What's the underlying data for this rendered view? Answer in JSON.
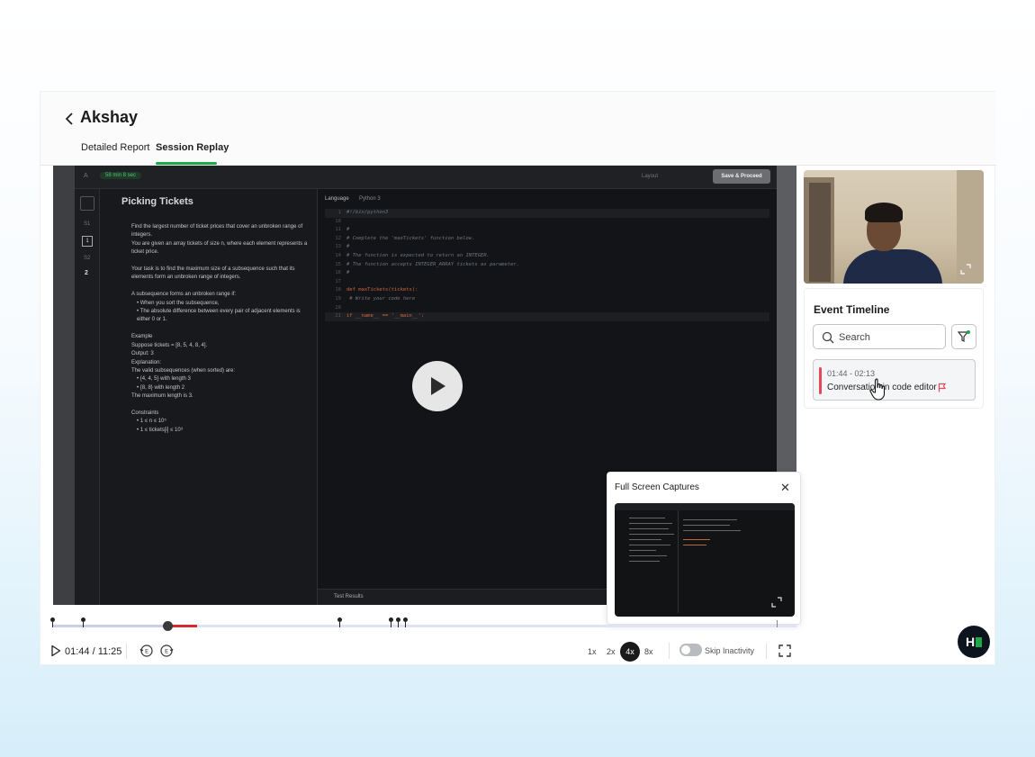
{
  "header": {
    "title": "Akshay",
    "tabs": [
      {
        "label": "Detailed Report"
      },
      {
        "label": "Session Replay"
      }
    ]
  },
  "video": {
    "topbar": {
      "a": "A",
      "timer": "58 min 8 sec",
      "layout": "Layout",
      "save": "Save & Proceed"
    },
    "qnav": {
      "s1": "S1",
      "n1": "1",
      "s2": "S2",
      "n2": "2"
    },
    "question": {
      "title": "Picking Tickets",
      "paragraphs": [
        "Find the largest number of ticket prices that cover an unbroken range of integers.",
        "You are given an array tickets of size n, where each element represents a ticket price.",
        "",
        "Your task is to find the maximum size of a subsequence such that its elements form an unbroken range of integers.",
        "",
        "A subsequence forms an unbroken range if:",
        "• When you sort the subsequence,",
        "• The absolute difference between every pair of adjacent elements is either 0 or 1.",
        "",
        "Example",
        "Suppose tickets = [8, 5, 4, 8, 4].",
        "Output: 3",
        "Explanation:",
        "The valid subsequences (when sorted) are:",
        "• {4, 4, 5} with length 3",
        "• {8, 8} with length 2",
        "The maximum length is 3.",
        "",
        "Constraints",
        "• 1 ≤ n ≤ 10⁵",
        "• 1 ≤ tickets[i] ≤ 10⁹"
      ]
    },
    "editor": {
      "language_label": "Language",
      "language": "Python 3",
      "lines": [
        {
          "n": "1",
          "t": "#!/bin/python3",
          "c": "cm"
        },
        {
          "n": "10",
          "t": "",
          "c": ""
        },
        {
          "n": "11",
          "t": "#",
          "c": "cm"
        },
        {
          "n": "12",
          "t": "# Complete the 'maxTickets' function below.",
          "c": "cm"
        },
        {
          "n": "13",
          "t": "#",
          "c": "cm"
        },
        {
          "n": "14",
          "t": "# The function is expected to return an INTEGER.",
          "c": "cm"
        },
        {
          "n": "15",
          "t": "# The function accepts INTEGER_ARRAY tickets as parameter.",
          "c": "cm"
        },
        {
          "n": "16",
          "t": "#",
          "c": "cm"
        },
        {
          "n": "17",
          "t": "",
          "c": ""
        },
        {
          "n": "18",
          "t": "def maxTickets(tickets):",
          "c": "kw"
        },
        {
          "n": "19",
          "t": "    # Write your code here",
          "c": "cm"
        },
        {
          "n": "20",
          "t": "",
          "c": ""
        },
        {
          "n": "21",
          "t": "if __name__ == '__main__':",
          "c": "kw"
        }
      ],
      "test_results": "Test Results"
    }
  },
  "events": {
    "title": "Event Timeline",
    "search_placeholder": "Search",
    "items": [
      {
        "time": "01:44 - 02:13",
        "text": "Conversation in code editor"
      }
    ]
  },
  "full_screen_captures": {
    "title": "Full Screen Captures"
  },
  "controls": {
    "time": "01:44 / 11:25",
    "speeds": [
      "1x",
      "2x",
      "4x",
      "8x"
    ],
    "active_speed": "4x",
    "skip_inactivity": "Skip Inactivity",
    "skip_inactivity_on": false,
    "progress": 0.154
  },
  "brand": {
    "mark": "H"
  },
  "colors": {
    "accent": "#1ba94c",
    "event_red": "#e8465a",
    "timeline_red": "#d7282f"
  }
}
